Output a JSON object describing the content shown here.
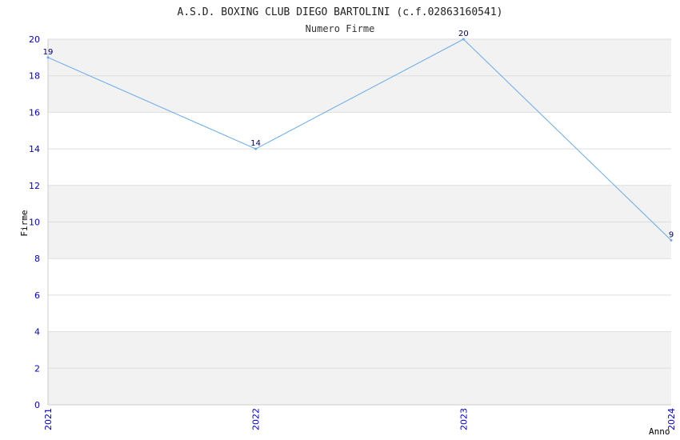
{
  "chart_data": {
    "type": "line",
    "title": "A.S.D. BOXING CLUB DIEGO BARTOLINI (c.f.02863160541)",
    "subtitle": "Numero Firme",
    "xlabel": "Anno",
    "ylabel": "Firme",
    "categories": [
      "2021",
      "2022",
      "2023",
      "2024"
    ],
    "series": [
      {
        "values": [
          19,
          14,
          20,
          9
        ],
        "data_labels": [
          "19",
          "14",
          "20",
          "9"
        ]
      }
    ],
    "ylim": [
      0,
      20
    ],
    "yticks": [
      "0",
      "2",
      "4",
      "6",
      "8",
      "10",
      "12",
      "14",
      "16",
      "18",
      "20"
    ],
    "grid": true,
    "colors": {
      "line": "#66aaee",
      "band": "#f2f2f2",
      "grid": "#dddddd",
      "tick_label": "#0000cc",
      "data_label": "#000066",
      "title": "#222222"
    }
  }
}
